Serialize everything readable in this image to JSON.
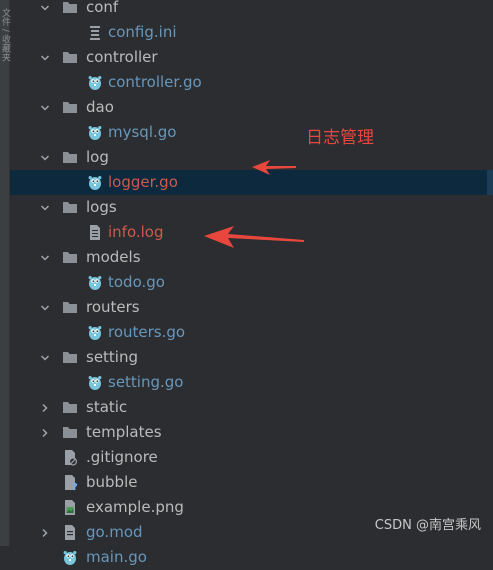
{
  "sidebar": {
    "vertical_label": "文件 / 收藏夹"
  },
  "tree": [
    {
      "label": "conf",
      "type": "folder",
      "expanded": true,
      "level": 1,
      "color": "plain"
    },
    {
      "label": "config.ini",
      "type": "ini",
      "level": 2,
      "color": "go"
    },
    {
      "label": "controller",
      "type": "folder",
      "expanded": true,
      "level": 1,
      "color": "plain"
    },
    {
      "label": "controller.go",
      "type": "go",
      "level": 2,
      "color": "go"
    },
    {
      "label": "dao",
      "type": "folder",
      "expanded": true,
      "level": 1,
      "color": "plain"
    },
    {
      "label": "mysql.go",
      "type": "go",
      "level": 2,
      "color": "go"
    },
    {
      "label": "log",
      "type": "folder",
      "expanded": true,
      "level": 1,
      "color": "plain"
    },
    {
      "label": "logger.go",
      "type": "go",
      "level": 2,
      "color": "red",
      "selected": true
    },
    {
      "label": "logs",
      "type": "folder",
      "expanded": true,
      "level": 1,
      "color": "plain"
    },
    {
      "label": "info.log",
      "type": "log",
      "level": 2,
      "color": "red"
    },
    {
      "label": "models",
      "type": "folder",
      "expanded": true,
      "level": 1,
      "color": "plain"
    },
    {
      "label": "todo.go",
      "type": "go",
      "level": 2,
      "color": "go"
    },
    {
      "label": "routers",
      "type": "folder",
      "expanded": true,
      "level": 1,
      "color": "plain"
    },
    {
      "label": "routers.go",
      "type": "go",
      "level": 2,
      "color": "go"
    },
    {
      "label": "setting",
      "type": "folder",
      "expanded": true,
      "level": 1,
      "color": "plain"
    },
    {
      "label": "setting.go",
      "type": "go",
      "level": 2,
      "color": "go"
    },
    {
      "label": "static",
      "type": "folder",
      "expanded": false,
      "level": 1,
      "color": "plain"
    },
    {
      "label": "templates",
      "type": "folder",
      "expanded": false,
      "level": 1,
      "color": "plain"
    },
    {
      "label": ".gitignore",
      "type": "gitignore",
      "level": 1,
      "color": "plain",
      "file": true
    },
    {
      "label": "bubble",
      "type": "unknown",
      "level": 1,
      "color": "plain",
      "file": true
    },
    {
      "label": "example.png",
      "type": "image",
      "level": 1,
      "color": "plain",
      "file": true
    },
    {
      "label": "go.mod",
      "type": "gomod",
      "expanded": false,
      "level": 1,
      "color": "go"
    },
    {
      "label": "main.go",
      "type": "go",
      "level": 1,
      "color": "go",
      "file": true
    }
  ],
  "annotation": {
    "text": "日志管理"
  },
  "watermark": {
    "text": "CSDN @南宫乘风"
  },
  "colors": {
    "background": "#2b2d30",
    "selection": "#0d293e",
    "go_file": "#6897bb",
    "error_file": "#cc5a4d",
    "annotation": "#e8473e"
  }
}
